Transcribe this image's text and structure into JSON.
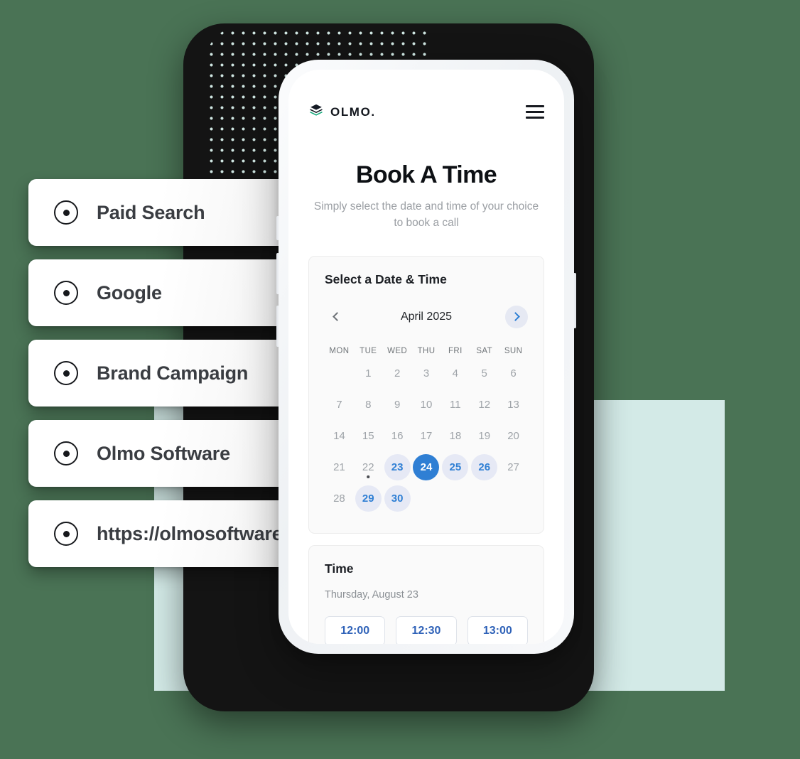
{
  "background": {
    "page_color": "#4a7355",
    "mint_panel_color": "#d3eae7",
    "dark_panel_color": "#141414"
  },
  "left_cards": [
    {
      "label": "Paid Search",
      "icon": "radio-selected-icon"
    },
    {
      "label": "Google",
      "icon": "radio-selected-icon"
    },
    {
      "label": "Brand Campaign",
      "icon": "radio-selected-icon"
    },
    {
      "label": "Olmo Software",
      "icon": "radio-selected-icon"
    },
    {
      "label": "https://olmosoftware",
      "icon": "radio-selected-icon"
    }
  ],
  "phone": {
    "appbar": {
      "brand_name": "OLMO.",
      "brand_icon": "layers-stack-icon",
      "menu_icon": "hamburger-menu-icon"
    },
    "hero": {
      "title": "Book A Time",
      "subtitle": "Simply select the date and time of your choice to book a call"
    },
    "date_panel": {
      "title": "Select a Date & Time",
      "prev_icon": "chevron-left-icon",
      "next_icon": "chevron-right-icon",
      "month": "April 2025",
      "weekdays": [
        "MON",
        "TUE",
        "WED",
        "THU",
        "FRI",
        "SAT",
        "SUN"
      ],
      "leading_blanks": 1,
      "days": [
        {
          "n": "1",
          "state": "disabled"
        },
        {
          "n": "2",
          "state": "disabled"
        },
        {
          "n": "3",
          "state": "disabled"
        },
        {
          "n": "4",
          "state": "disabled"
        },
        {
          "n": "5",
          "state": "disabled"
        },
        {
          "n": "6",
          "state": "disabled"
        },
        {
          "n": "7",
          "state": "disabled"
        },
        {
          "n": "8",
          "state": "disabled"
        },
        {
          "n": "9",
          "state": "disabled"
        },
        {
          "n": "10",
          "state": "disabled"
        },
        {
          "n": "11",
          "state": "disabled"
        },
        {
          "n": "12",
          "state": "disabled"
        },
        {
          "n": "13",
          "state": "disabled"
        },
        {
          "n": "14",
          "state": "disabled"
        },
        {
          "n": "15",
          "state": "disabled"
        },
        {
          "n": "16",
          "state": "disabled"
        },
        {
          "n": "17",
          "state": "disabled"
        },
        {
          "n": "18",
          "state": "disabled"
        },
        {
          "n": "19",
          "state": "disabled"
        },
        {
          "n": "20",
          "state": "disabled"
        },
        {
          "n": "21",
          "state": "disabled"
        },
        {
          "n": "22",
          "state": "today"
        },
        {
          "n": "23",
          "state": "available"
        },
        {
          "n": "24",
          "state": "selected"
        },
        {
          "n": "25",
          "state": "available"
        },
        {
          "n": "26",
          "state": "available"
        },
        {
          "n": "27",
          "state": "disabled"
        },
        {
          "n": "28",
          "state": "disabled"
        },
        {
          "n": "29",
          "state": "available"
        },
        {
          "n": "30",
          "state": "available"
        }
      ],
      "colors": {
        "selected_bg": "#2f7fd4",
        "available_bg": "#e6e9f5",
        "available_text": "#2f7fd4",
        "disabled_text": "#9ea3a8"
      }
    },
    "time_panel": {
      "title": "Time",
      "date": "Thursday, August 23",
      "slots": [
        "12:00",
        "12:30",
        "13:00"
      ]
    }
  }
}
